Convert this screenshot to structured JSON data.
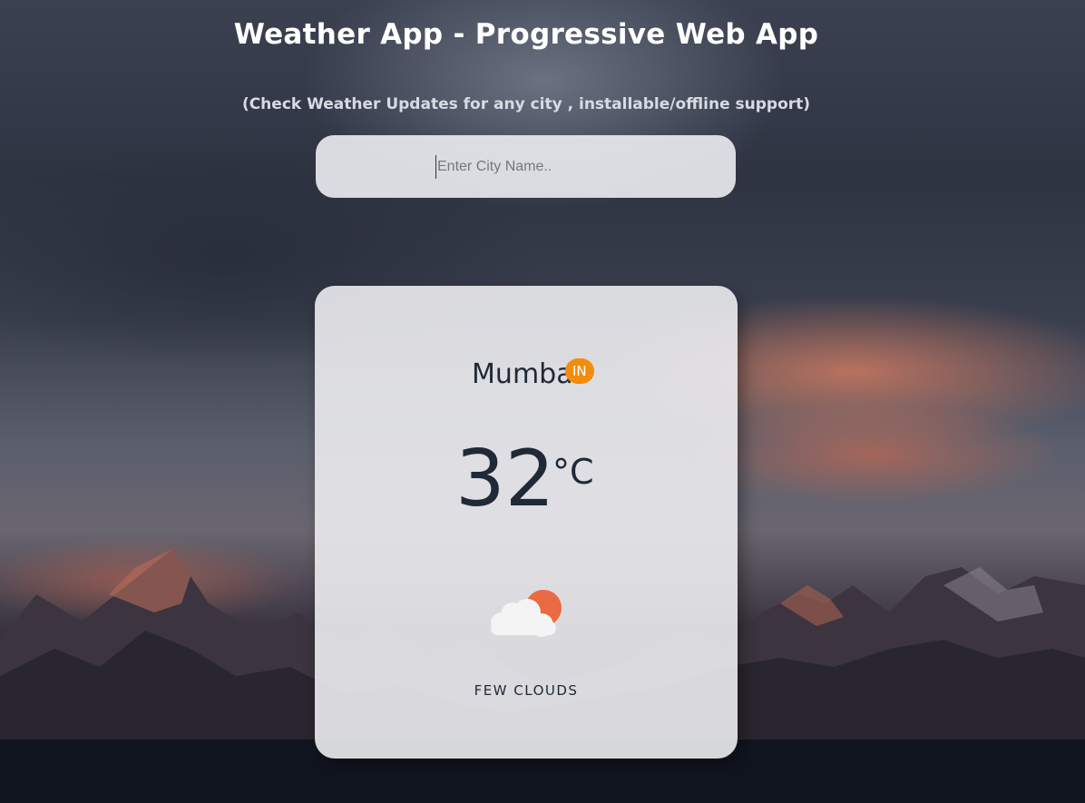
{
  "header": {
    "title": "Weather App - Progressive Web App",
    "subtitle": "(Check Weather Updates for any city , installable/offline support)"
  },
  "search": {
    "placeholder": "Enter City Name.."
  },
  "weather": {
    "city": "Mumbai",
    "country": "IN",
    "temperature": "32",
    "unit": "°C",
    "description": "FEW CLOUDS",
    "icon": "few-clouds-day-icon"
  },
  "colors": {
    "badge": "#f28c0a",
    "sun": "#ea6a43",
    "text": "#1f2937"
  }
}
